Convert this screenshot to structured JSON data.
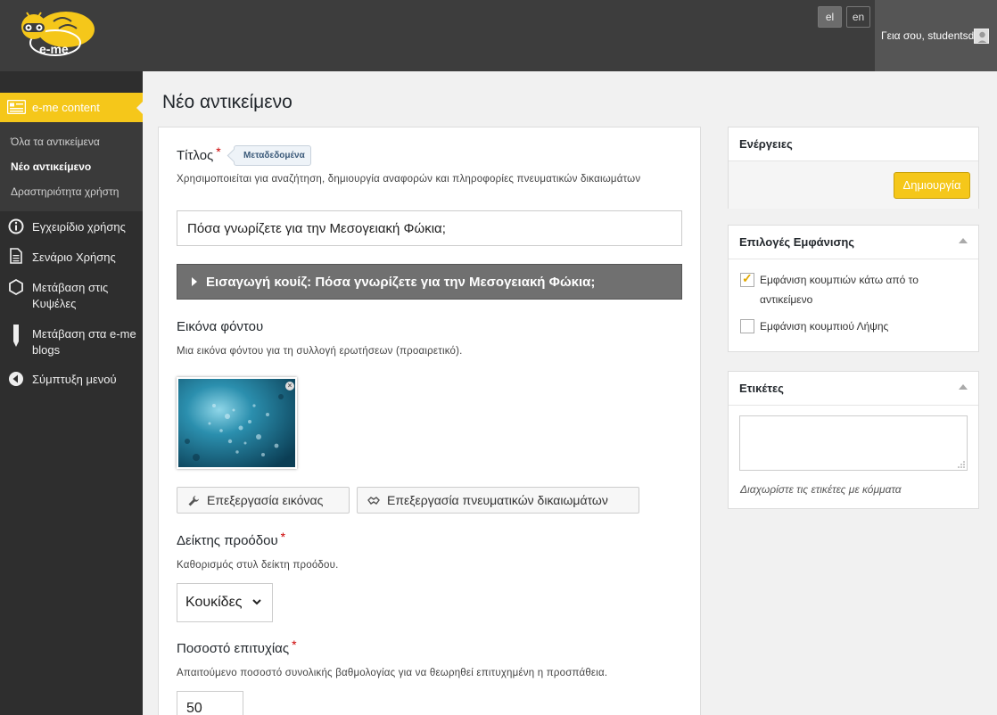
{
  "brand": {
    "logo_text": "e-me",
    "accent_color": "#f5c71a",
    "topbar_color": "#3d3d3d",
    "sidebar_color": "#2e2e2e"
  },
  "header": {
    "languages": [
      "el",
      "en"
    ],
    "active_language": "el",
    "greeting": "Γεια σου, studentsd"
  },
  "sidebar": {
    "active_section": {
      "label": "e-me content",
      "icon": "content-list-icon"
    },
    "submenu": [
      {
        "label": "Όλα τα αντικείμενα",
        "current": false
      },
      {
        "label": "Νέο αντικείμενο",
        "current": true
      },
      {
        "label": "Δραστηριότητα χρήστη",
        "current": false
      }
    ],
    "items": [
      {
        "label": "Εγχειρίδιο χρήσης",
        "icon": "info-icon"
      },
      {
        "label": "Σενάριο Χρήσης",
        "icon": "document-icon"
      },
      {
        "label": "Μετάβαση στις Κυψέλες",
        "icon": "hexagon-icon"
      },
      {
        "label": "Μετάβαση στα e-me blogs",
        "icon": "pencil-icon"
      },
      {
        "label": "Σύμπτυξη μενού",
        "icon": "collapse-icon"
      }
    ]
  },
  "page": {
    "title": "Νέο αντικείμενο"
  },
  "form": {
    "title_field": {
      "label": "Τίτλος",
      "required": "*",
      "meta_tag": "Μεταδεδομένα",
      "description": "Χρησιμοποιείται για αναζήτηση, δημιουργία αναφορών και πληροφορίες πνευματικών δικαιωμάτων",
      "value": "Πόσα γνωρίζετε για την Μεσογειακή Φώκια;"
    },
    "intro_section": {
      "label": "Εισαγωγή κουίζ: Πόσα γνωρίζετε για την Μεσογειακή Φώκια;"
    },
    "background_image": {
      "label": "Εικόνα φόντου",
      "description": "Μια εικόνα φόντου για τη συλλογή ερωτήσεων (προαιρετικό).",
      "edit_image_label": "Επεξεργασία εικόνας",
      "edit_copyright_label": "Επεξεργασία πνευματικών δικαιωμάτων"
    },
    "progress_indicator": {
      "label": "Δείκτης προόδου",
      "required": "*",
      "description": "Καθορισμός στυλ δείκτη προόδου.",
      "selected": "Κουκίδες"
    },
    "pass_percentage": {
      "label": "Ποσοστό επιτυχίας",
      "required": "*",
      "description": "Απαιτούμενο ποσοστό συνολικής βαθμολογίας για να θεωρηθεί επιτυχημένη η προσπάθεια.",
      "value": "50"
    }
  },
  "actions_panel": {
    "title": "Ενέργειες",
    "create_label": "Δημιουργία"
  },
  "display_panel": {
    "title": "Επιλογές Εμφάνισης",
    "options": [
      {
        "label": "Εμφάνιση κουμπιών κάτω από το αντικείμενο",
        "checked": true
      },
      {
        "label": "Εμφάνιση κουμπιού Λήψης",
        "checked": false
      }
    ]
  },
  "tags_panel": {
    "title": "Ετικέτες",
    "hint": "Διαχωρίστε τις ετικέτες με κόμματα"
  }
}
